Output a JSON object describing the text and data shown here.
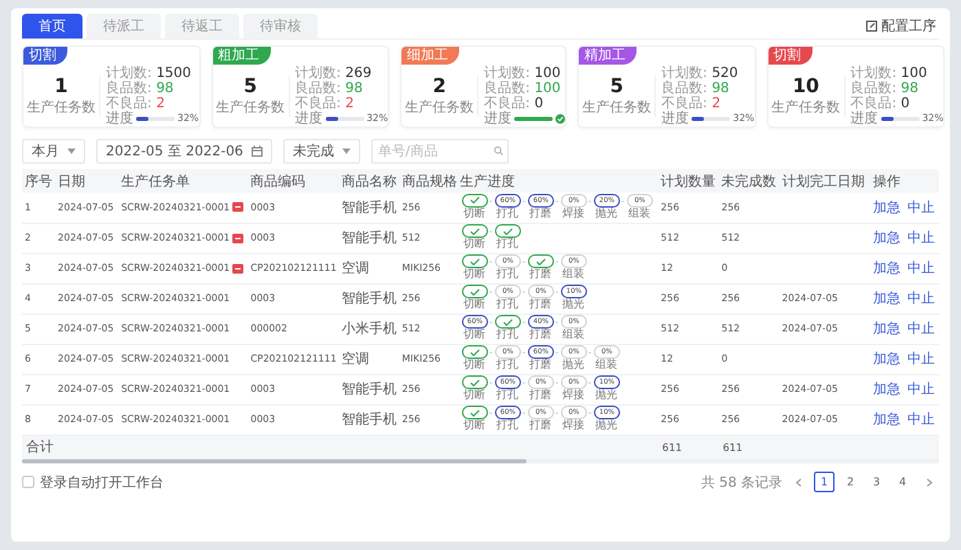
{
  "tabs": [
    {
      "label": "首页",
      "selected": true
    },
    {
      "label": "待派工",
      "selected": false
    },
    {
      "label": "待返工",
      "selected": false
    },
    {
      "label": "待审核",
      "selected": false
    }
  ],
  "config_button": "配置工序",
  "cards": [
    {
      "tag": "切割",
      "color": "#3b5bdb",
      "count": "1",
      "count_label": "生产任务数",
      "plan_label": "计划数:",
      "plan": "1500",
      "good_label": "良品数:",
      "good": "98",
      "bad_label": "不良品:",
      "bad": "2",
      "progress_label": "进度",
      "level": 0.32,
      "complete": false,
      "percent": "32%"
    },
    {
      "tag": "粗加工",
      "color": "#2fa84f",
      "count": "5",
      "count_label": "生产任务数",
      "plan_label": "计划数:",
      "plan": "269",
      "good_label": "良品数:",
      "good": "98",
      "bad_label": "不良品:",
      "bad": "2",
      "progress_label": "进度",
      "level": 0.32,
      "complete": false,
      "percent": "32%"
    },
    {
      "tag": "细加工",
      "color": "#f07a55",
      "count": "2",
      "count_label": "生产任务数",
      "plan_label": "计划数:",
      "plan": "100",
      "good_label": "良品数:",
      "good": "100",
      "bad_label": "不良品:",
      "bad": "0",
      "progress_label": "进度",
      "level": 1,
      "complete": true
    },
    {
      "tag": "精加工",
      "color": "#a557e6",
      "count": "5",
      "count_label": "生产任务数",
      "plan_label": "计划数:",
      "plan": "520",
      "good_label": "良品数:",
      "good": "98",
      "bad_label": "不良品:",
      "bad": "2",
      "progress_label": "进度",
      "level": 0.32,
      "complete": false,
      "percent": "32%"
    },
    {
      "tag": "切割",
      "color": "#e5484d",
      "count": "10",
      "count_label": "生产任务数",
      "plan_label": "计划数:",
      "plan": "100",
      "good_label": "良品数:",
      "good": "98",
      "bad_label": "不良品:",
      "bad": "0",
      "progress_label": "进度",
      "level": 0.32,
      "complete": false,
      "percent": "32%"
    }
  ],
  "filters": {
    "period": "本月",
    "date_range": "2022-05 至 2022-06",
    "status": "未完成",
    "search": {
      "placeholder": "单号/商品"
    }
  },
  "table": {
    "columns": [
      "序号",
      "日期",
      "生产任务单",
      "商品编码",
      "商品名称",
      "商品规格",
      "生产进度",
      "计划数量",
      "未完成数",
      "计划完工日期",
      "操作"
    ],
    "rows": [
      {
        "seq": "1",
        "date": "2024-07-05",
        "task": "SCRW-20240321-0001",
        "urgent": true,
        "code": "0003",
        "name": "智能手机",
        "spec": "256",
        "steps": [
          {
            "kind": "done",
            "label": "切断"
          },
          {
            "kind": "active",
            "text": "60%",
            "label": "打孔"
          },
          {
            "kind": "active",
            "text": "60%",
            "label": "打磨"
          },
          {
            "kind": "idle",
            "text": "0%",
            "label": "焊接"
          },
          {
            "kind": "active",
            "text": "20%",
            "label": "抛光"
          },
          {
            "kind": "idle",
            "text": "0%",
            "label": "组装"
          }
        ],
        "plan": "256",
        "remaining": "256",
        "actions": [
          "加急",
          "中止"
        ]
      },
      {
        "seq": "2",
        "date": "2024-07-05",
        "task": "SCRW-20240321-0001",
        "urgent": true,
        "code": "0003",
        "name": "智能手机",
        "spec": "512",
        "steps": [
          {
            "kind": "done",
            "label": "切断"
          },
          {
            "kind": "done",
            "label": "打孔"
          }
        ],
        "plan": "512",
        "remaining": "512",
        "actions": [
          "加急",
          "中止"
        ]
      },
      {
        "seq": "3",
        "date": "2024-07-05",
        "task": "SCRW-20240321-0001",
        "urgent": true,
        "code": "CP202102121111",
        "name": "空调",
        "spec": "MIKI256",
        "steps": [
          {
            "kind": "done",
            "label": "切断"
          },
          {
            "kind": "idle",
            "text": "0%",
            "label": "打孔"
          },
          {
            "kind": "done",
            "label": "打磨"
          },
          {
            "kind": "idle",
            "text": "0%",
            "label": "组装"
          }
        ],
        "plan": "12",
        "remaining": "0",
        "actions": [
          "加急",
          "中止"
        ]
      },
      {
        "seq": "4",
        "date": "2024-07-05",
        "task": "SCRW-20240321-0001",
        "urgent": false,
        "code": "0003",
        "name": "智能手机",
        "spec": "256",
        "steps": [
          {
            "kind": "done",
            "label": "切断"
          },
          {
            "kind": "idle",
            "text": "0%",
            "label": "打孔"
          },
          {
            "kind": "idle",
            "text": "0%",
            "label": "打磨"
          },
          {
            "kind": "active",
            "text": "10%",
            "label": "抛光"
          }
        ],
        "plan": "256",
        "remaining": "256",
        "due": "2024-07-05",
        "actions": [
          "加急",
          "中止"
        ]
      },
      {
        "seq": "5",
        "date": "2024-07-05",
        "task": "SCRW-20240321-0001",
        "urgent": false,
        "code": "000002",
        "name": "小米手机",
        "spec": "512",
        "steps": [
          {
            "kind": "active",
            "text": "60%",
            "label": "切断"
          },
          {
            "kind": "done",
            "label": "打孔"
          },
          {
            "kind": "active",
            "text": "40%",
            "label": "打磨"
          },
          {
            "kind": "idle",
            "text": "0%",
            "label": "组装"
          }
        ],
        "plan": "512",
        "remaining": "512",
        "due": "2024-07-05",
        "actions": [
          "加急",
          "中止"
        ]
      },
      {
        "seq": "6",
        "date": "2024-07-05",
        "task": "SCRW-20240321-0001",
        "urgent": false,
        "code": "CP202102121111",
        "name": "空调",
        "spec": "MIKI256",
        "steps": [
          {
            "kind": "done",
            "label": "切断"
          },
          {
            "kind": "idle",
            "text": "0%",
            "label": "打孔"
          },
          {
            "kind": "active",
            "text": "60%",
            "label": "打磨"
          },
          {
            "kind": "idle",
            "text": "0%",
            "label": "抛光"
          },
          {
            "kind": "idle",
            "text": "0%",
            "label": "组装"
          }
        ],
        "plan": "12",
        "remaining": "0",
        "actions": [
          "加急",
          "中止"
        ]
      },
      {
        "seq": "7",
        "date": "2024-07-05",
        "task": "SCRW-20240321-0001",
        "urgent": false,
        "code": "0003",
        "name": "智能手机",
        "spec": "256",
        "steps": [
          {
            "kind": "done",
            "label": "切断"
          },
          {
            "kind": "active",
            "text": "60%",
            "label": "打孔"
          },
          {
            "kind": "idle",
            "text": "0%",
            "label": "打磨"
          },
          {
            "kind": "idle",
            "text": "0%",
            "label": "焊接"
          },
          {
            "kind": "active",
            "text": "10%",
            "label": "抛光"
          }
        ],
        "plan": "256",
        "remaining": "256",
        "due": "2024-07-05",
        "actions": [
          "加急",
          "中止"
        ]
      },
      {
        "seq": "8",
        "date": "2024-07-05",
        "task": "SCRW-20240321-0001",
        "urgent": false,
        "code": "0003",
        "name": "智能手机",
        "spec": "256",
        "steps": [
          {
            "kind": "done",
            "label": "切断"
          },
          {
            "kind": "active",
            "text": "60%",
            "label": "打孔"
          },
          {
            "kind": "idle",
            "text": "0%",
            "label": "打磨"
          },
          {
            "kind": "idle",
            "text": "0%",
            "label": "焊接"
          },
          {
            "kind": "active",
            "text": "10%",
            "label": "抛光"
          }
        ],
        "plan": "256",
        "remaining": "256",
        "due": "2024-07-05",
        "actions": [
          "加急",
          "中止"
        ]
      }
    ],
    "total": {
      "label": "合计",
      "plan": "611",
      "remaining": "611"
    }
  },
  "auto_open": {
    "label": "登录自动打开工作台",
    "checked": false
  },
  "pagination": {
    "summary": "共 58 条记录",
    "pages": [
      {
        "label": "1",
        "selected": true
      },
      {
        "label": "2",
        "selected": false
      },
      {
        "label": "3",
        "selected": false
      },
      {
        "label": "4",
        "selected": false
      }
    ]
  }
}
